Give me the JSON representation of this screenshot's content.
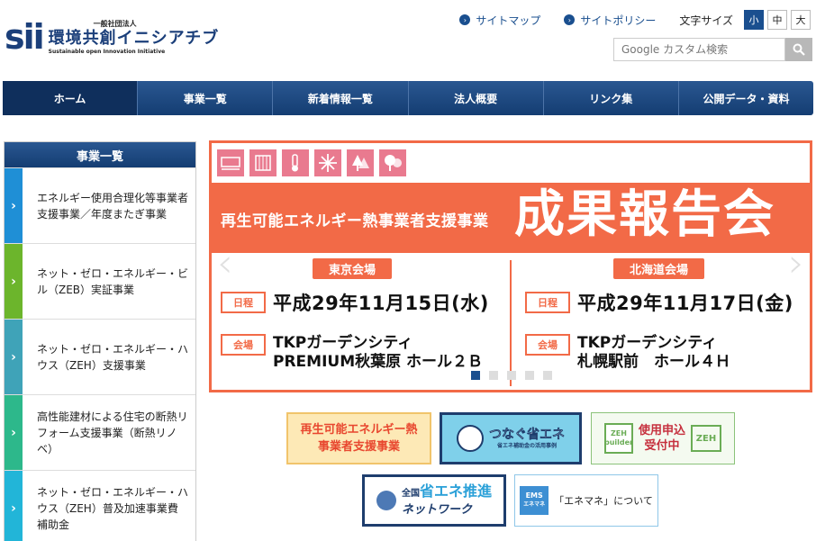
{
  "header": {
    "logo_mark": "sii",
    "logo_small": "一般社団法人",
    "logo_name": "環境共創イニシアチブ",
    "logo_sub": "Sustainable open Innovation Initiative",
    "sitemap_label": "サイトマップ",
    "policy_label": "サイトポリシー",
    "font_size_label": "文字サイズ",
    "font_sizes": [
      "小",
      "中",
      "大"
    ],
    "search_placeholder": "Google カスタム検索"
  },
  "nav": {
    "items": [
      "ホーム",
      "事業一覧",
      "新着情報一覧",
      "法人概要",
      "リンク集",
      "公開データ・資料"
    ]
  },
  "sidebar": {
    "title": "事業一覧",
    "items": [
      {
        "label": "エネルギー使用合理化等事業者支援事業／年度またぎ事業",
        "color": "#1f8fd6"
      },
      {
        "label": "ネット・ゼロ・エネルギー・ビル（ZEB）実証事業",
        "color": "#6cb52c"
      },
      {
        "label": "ネット・ゼロ・エネルギー・ハウス（ZEH）支援事業",
        "color": "#3fa3b8"
      },
      {
        "label": "高性能建材による住宅の断熱リフォーム支援事業（断熱リノベ）",
        "color": "#2db88b"
      },
      {
        "label": "ネット・ゼロ・エネルギー・ハウス（ZEH）普及加速事業費補助金",
        "color": "#22b5d8"
      }
    ]
  },
  "banner": {
    "subtitle": "再生可能エネルギー熱事業者支援事業",
    "main_title": "成果報告会",
    "schedule_tag": "日程",
    "venue_tag": "会場",
    "tokyo": {
      "badge": "東京会場",
      "date": "平成29年11月15日(水)",
      "place_line1": "TKPガーデンシティ",
      "place_line2": "PREMIUM秋葉原 ホール２Ｂ"
    },
    "hokkaido": {
      "badge": "北海道会場",
      "date": "平成29年11月17日(金)",
      "place_line1": "TKPガーデンシティ",
      "place_line2": "札幌駅前　ホール４Ｈ"
    },
    "prev_arrow": "‹",
    "next_arrow": "›",
    "slide_count": 5,
    "active_slide": 1,
    "accent_color": "#f26a47"
  },
  "links": {
    "renewable": {
      "line1": "再生可能エネルギー熱",
      "line2": "事業者支援事業"
    },
    "tsunagu": {
      "title": "つなぐ省エネ",
      "small": "省エネ補助金の活用事例"
    },
    "zeh": {
      "house_top": "ZEH",
      "house_bottom": "builder",
      "line1": "使用申込",
      "line2": "受付中",
      "badge": "ZEH"
    },
    "network": {
      "prefix": "全国",
      "big": "省エネ推進",
      "line2": "ネットワーク"
    },
    "ems": {
      "logo": "EMS",
      "logo_sub": "エネマネ",
      "text": "「エネマネ」について"
    }
  }
}
